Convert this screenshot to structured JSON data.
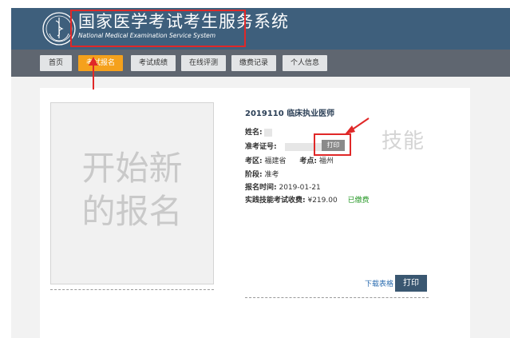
{
  "header": {
    "title": "国家医学考试考生服务系统",
    "subtitle": "National Medical Examination Service System",
    "accent": "#3e5f7c"
  },
  "nav": {
    "items": [
      {
        "label": "首页",
        "active": false
      },
      {
        "label": "考试报名",
        "active": true
      },
      {
        "label": "考试成绩",
        "active": false
      },
      {
        "label": "在线评测",
        "active": false
      },
      {
        "label": "缴费记录",
        "active": false
      },
      {
        "label": "个人信息",
        "active": false
      }
    ]
  },
  "new_registration": {
    "label": "开始新\n的报名"
  },
  "registration": {
    "title": "2019110 临床执业医师",
    "name_label": "姓名:",
    "ticket_label": "准考证号:",
    "ticket_print": "打印",
    "region_label": "考区:",
    "region_value": "福建省",
    "site_label": "考点:",
    "site_value": "福州",
    "stage_label": "阶段:",
    "stage_value": "准考",
    "time_label": "报名时间:",
    "time_value": "2019-01-21",
    "fee_label": "实践技能考试收费:",
    "fee_value": "¥219.00",
    "fee_status": "已缴费",
    "status_color": "#2a9a2a"
  },
  "watermark": "技能",
  "actions": {
    "download": "下载表格",
    "print": "打印"
  }
}
